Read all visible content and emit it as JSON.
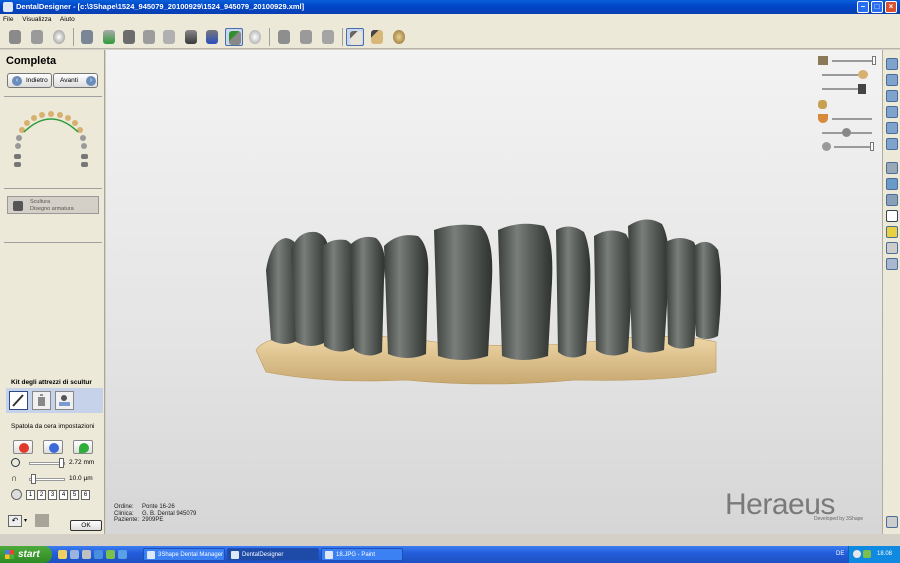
{
  "window": {
    "title": "DentalDesigner - [c:\\3Shape\\1524_945079_20100929\\1524_945079_20100929.xml]"
  },
  "menu": [
    "File",
    "Visualizza",
    "Aiuto"
  ],
  "left_panel": {
    "step_title": "Completa",
    "back_label": "Indietro",
    "forward_label": "Avanti",
    "sculpt_button_line1": "Scultura",
    "sculpt_button_line2": "Disegno armatura",
    "kit_title": "Kit degli attrezzi di scultur",
    "spatula_title": "Spatola da cera impostazioni",
    "size_value": "2.72 mm",
    "thickness_value": "10.0 µm",
    "number_buttons": [
      "1",
      "2",
      "3",
      "4",
      "5",
      "6"
    ],
    "ok_label": "OK"
  },
  "viewport": {
    "info": [
      {
        "label": "Ordine:",
        "value": "Ponte 16-26"
      },
      {
        "label": "Clinica:",
        "value": "G. B. Dental 945079"
      },
      {
        "label": "Paziente:",
        "value": "2909PE"
      }
    ],
    "brand": "Heraeus",
    "brand_sub": "Developed by 3Shape"
  },
  "taskbar": {
    "start_label": "start",
    "tasks": [
      "3Shape Dental Manager",
      "DentalDesigner",
      "18.JPG - Paint"
    ],
    "language": "DE",
    "clock": "18.08"
  },
  "colors": {
    "crown": "#5c605c",
    "gingiva": "#e2c894",
    "titlebar": "#0046c8",
    "panel": "#ece9d8"
  }
}
